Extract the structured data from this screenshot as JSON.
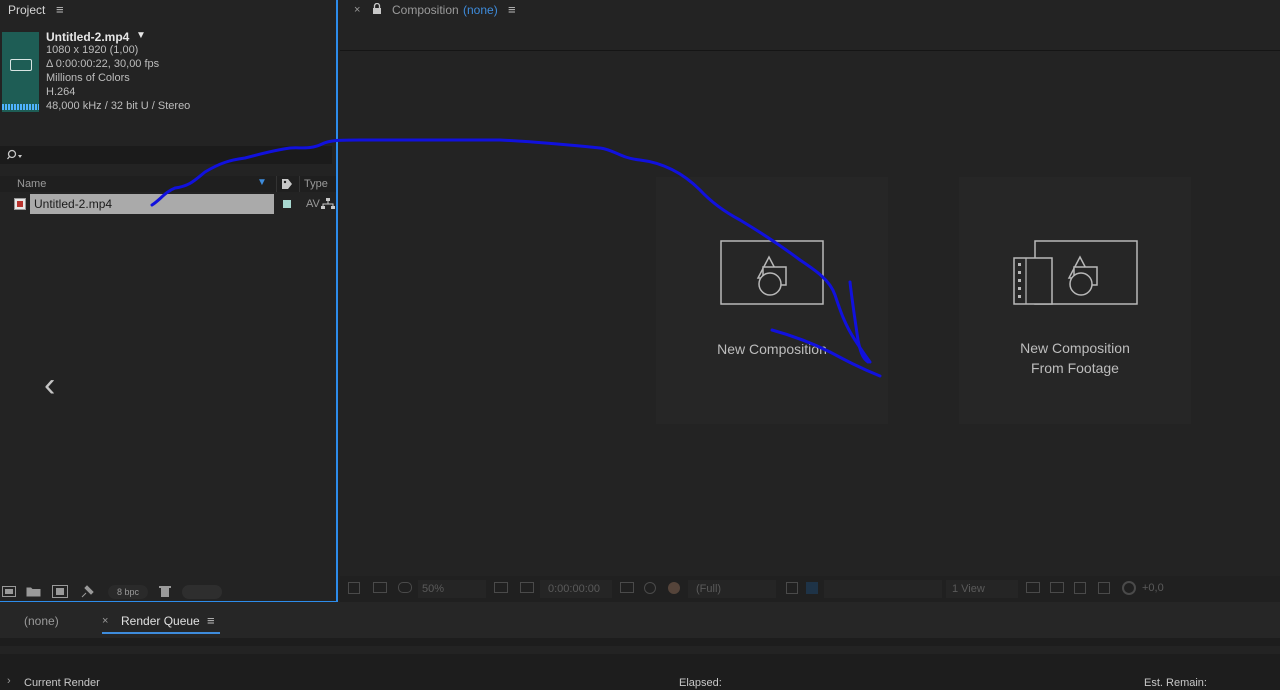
{
  "project": {
    "tab_label": "Project",
    "file": {
      "name": "Untitled-2.mp4",
      "dimensions": "1080 x 1920 (1,00)",
      "duration": "Δ 0:00:00:22, 30,00 fps",
      "colors": "Millions of Colors",
      "codec": "H.264",
      "audio": "48,000 kHz / 32 bit U / Stereo"
    },
    "columns": {
      "name": "Name",
      "type": "Type"
    },
    "row": {
      "name": "Untitled-2.mp4",
      "type": "AV"
    },
    "footer": {
      "bpc": "8 bpc"
    }
  },
  "composition": {
    "tab_label": "Composition",
    "tab_value": "(none)",
    "cards": [
      {
        "label": "New Composition"
      },
      {
        "label_line1": "New Composition",
        "label_line2": "From Footage"
      }
    ],
    "toolbar": {
      "zoom": "50%",
      "timecode": "0:00:00:00",
      "resolution": "(Full)",
      "views": "1 View",
      "exposure": "+0,0"
    }
  },
  "render_queue": {
    "tab_none": "(none)",
    "tab_label": "Render Queue",
    "current_render": "Current Render",
    "elapsed": "Elapsed:",
    "est_remain": "Est. Remain:"
  },
  "colors": {
    "accent_blue": "#2d8ceb",
    "annotation_blue": "#1010e0",
    "thumbnail_teal": "#1e5d55"
  }
}
